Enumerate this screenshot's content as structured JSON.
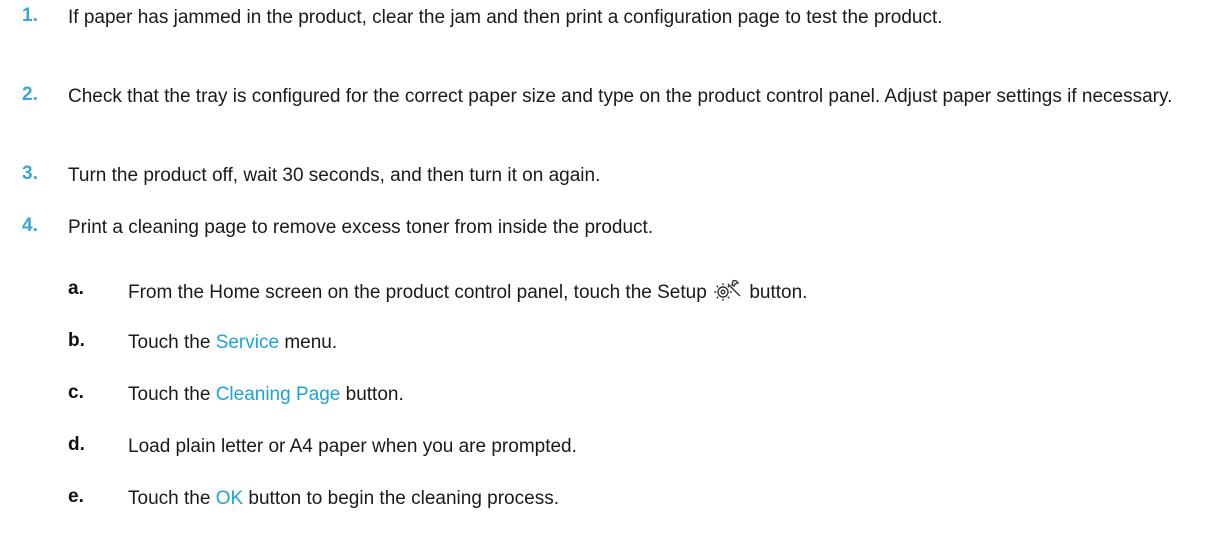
{
  "steps": [
    {
      "num": "1.",
      "text": "If paper has jammed in the product, clear the jam and then print a configuration page to test the product."
    },
    {
      "num": "2.",
      "text": "Check that the tray is configured for the correct paper size and type on the product control panel. Adjust paper settings if necessary."
    },
    {
      "num": "3.",
      "text": "Turn the product off, wait 30 seconds, and then turn it on again."
    },
    {
      "num": "4.",
      "text": "Print a cleaning page to remove excess toner from inside the product."
    }
  ],
  "substeps": [
    {
      "num": "a.",
      "before": "From the Home screen on the product control panel, touch the Setup",
      "after": "button.",
      "icon": "setup-icon"
    },
    {
      "num": "b.",
      "before": "Touch the",
      "ui": "Service",
      "after": "menu."
    },
    {
      "num": "c.",
      "before": "Touch the",
      "ui": "Cleaning Page",
      "after": "button."
    },
    {
      "num": "d.",
      "text": "Load plain letter or A4 paper when you are prompted."
    },
    {
      "num": "e.",
      "before": "Touch the",
      "ui": "OK",
      "after": "button to begin the cleaning process."
    }
  ],
  "colors": {
    "step_number": "#3aa6d5",
    "ui_term": "#1da3d9",
    "text": "#1a1a1a"
  }
}
